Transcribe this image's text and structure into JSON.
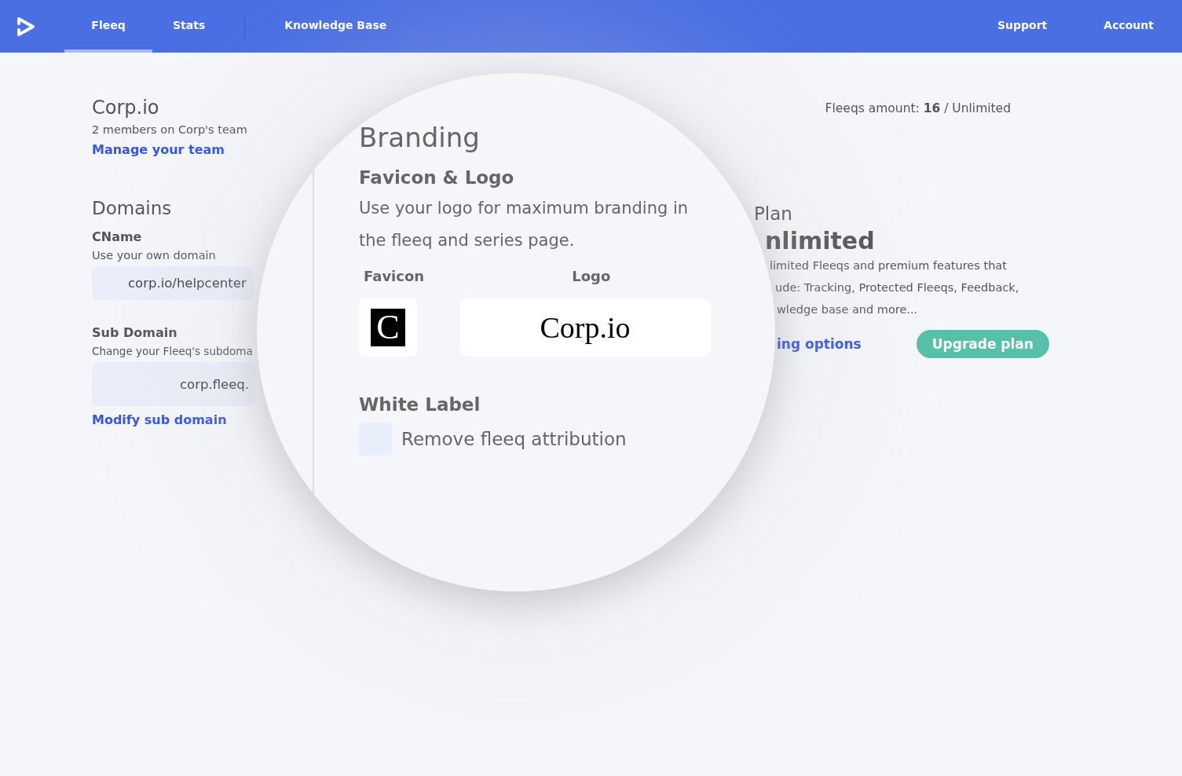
{
  "nav": {
    "tabs": [
      {
        "label": "Fleeq",
        "selected": true
      },
      {
        "label": "Stats",
        "selected": false
      },
      {
        "label": "Knowledge Base",
        "selected": false
      }
    ],
    "right_links": [
      "Support",
      "Account"
    ]
  },
  "account": {
    "name": "Corp.io",
    "members": "2 members on Corp's team",
    "manage_link": "Manage your team"
  },
  "domains": {
    "title": "Domains",
    "cname": {
      "label": "CName",
      "hint": "Use your own domain",
      "value": "corp.io/helpcenter"
    },
    "sub_domain": {
      "label": "Sub Domain",
      "hint": "Change your Fleeq's subdoma",
      "value": "corp.fleeq.",
      "link": "Modify sub domain"
    }
  },
  "usage": "Fleeqs amount: **16** / Unlimited",
  "plan": {
    "title": "Plan",
    "name": "nlimited",
    "description_lines": [
      "limited Fleeqs and premium features that",
      "ude: Tracking, Protected Fleeqs, Feedback,",
      "wledge base and more..."
    ],
    "link": "ing options",
    "button": "Upgrade plan"
  },
  "magnifier": {
    "title": "Branding",
    "favicon_logo": {
      "heading": "Favicon & Logo",
      "text": "Use your logo for maximum branding in the fleeq and series page.",
      "favicon_label": "Favicon",
      "logo_label": "Logo",
      "favicon_letter": "C",
      "logo_text": "Corp.io"
    },
    "white_label": {
      "heading": "White Label",
      "checkbox_label": "Remove fleeq attribution",
      "checked": false
    }
  }
}
